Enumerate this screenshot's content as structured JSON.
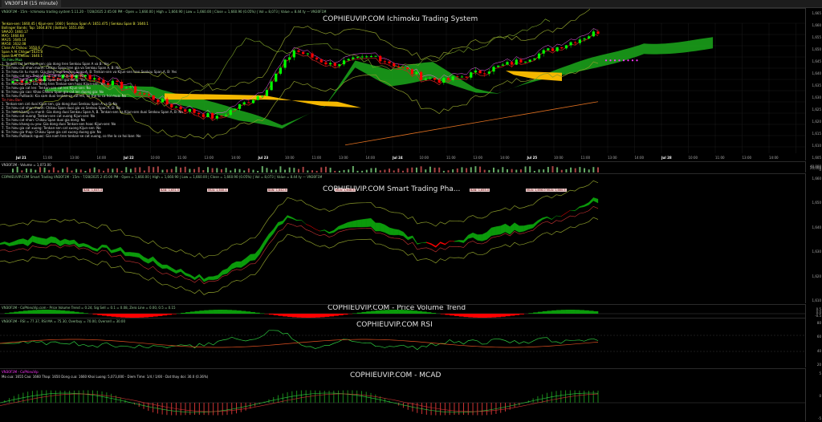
{
  "window": {
    "tab_title": "VN30F1M (15 minute)"
  },
  "panes": {
    "ichimoku": {
      "title": "COPHIEUVIP.COM Ichimoku Trading System",
      "header": "VN30F1M - 15m - Ichimoku trading system 5.11.20 - 7/28/2025 2:45:00 PM - Open = 1,660.00 | High = 1,660.90 | Low = 1,660.00 | Close = 1,660.90 (0.05%) | Vol = 8,073 | Value = 8.44 ty — VN30F1M",
      "info_lines": [
        "Tenkan-sen: 1660.45 | Kijun-sen: 1660 | Senkou Span A: 1651.475 | Senkou Span B: 1640.1",
        "Bollinger Bands: Top: 1664.874 | Bottom: 1651.466",
        "SMA20: 1660.17",
        "MA5: 1660.68",
        "MA25: 1646.14",
        "MA50: 1632.08",
        "Close At Chikou: 1650.6",
        "Span A At Chikou: 1631.8",
        "Span B At Chikou: 1640.1",
        "Tin hieu Mua",
        "1. Tenkan cat len Kijun-sen: gia dong tren Senkou Span A va B: Yes",
        "2. Tin hieu cat nhan manh: Chikou Span tren gia va Senkou Span A, B: No",
        "3. Tin hieu tin tu manh: Gia dong tren Senkou Span A, B. Tenkan-sen va Kijun-sen tren Senkou Span A, B: Yes",
        "4. Tin hieu cat len: Tenkan-sen cat len Kijun-sen: No",
        "5. Tin hieu cat nhan: Chikou Span tren gia dong: Yes",
        "6. Tin hieu tin yeu: Gia dong tren Tenkan-sen hoac Kijun-sen: Yes",
        "7. Tin hieu gia cat len: Tenkan-sen cat len Kijun-sen: No",
        "8. Tin hieu gia cao: Khao Chikou Span gia cat len duong gia: No",
        "9. Tin hieu Pullback: Kia sam duoi tenkan-se cat len, co the tu ca hoi mua: No",
        "Tin hieu Ban",
        "1. Tenkan-sen cat duoi Kijun-sen, gia dong duoi Senkou Span A va B: No",
        "2. Tin hieu cat nhan manh: Chikou Span duoi gia va Senkou Span A, B: No",
        "3. Tin hieu khang cu manh: Gia dong duoi Senkou Span A, B. Tenkan-sen va Kijun-sen duoi Senkou Span A, B: No",
        "4. Tin hieu cat xuong: Tenkan-sen cat xuong Kijun-sen: No",
        "5. Tin hieu cat nhan: Chikou Span duoi gia dong: No",
        "6. Tin hieu khang cu yeu: Gia dong duoi Tenkan-sen hoac Kijun-sen: No",
        "7. Tin hieu gia cat xuong: Tenkan-sen cat xuong Kijun-sen: No",
        "8. Tin hieu gia thap: Chikou Span gia cat xuong duong gia: No",
        "9. Tin hieu Pullback nguoc: Gia nam tren tenkan-se cat xuong, co the la co hoi ban: No"
      ],
      "x_labels": [
        "Jul 21",
        "11:00",
        "13:00",
        "14:00",
        "Jul 22",
        "10:00",
        "11:00",
        "13:00",
        "14:00",
        "Jul 23",
        "10:00",
        "11:00",
        "13:00",
        "14:00",
        "Jul 24",
        "10:00",
        "11:00",
        "13:00",
        "14:00",
        "Jul 25",
        "10:00",
        "11:00",
        "13:00",
        "14:00",
        "Jul 28",
        "10:00",
        "11:00",
        "13:00",
        "14:00"
      ],
      "y_labels": [
        "1,665",
        "1,660",
        "1,655",
        "1,650",
        "1,645",
        "1,640",
        "1,635",
        "1,630",
        "1,625",
        "1,620",
        "1,615",
        "1,610",
        "1,605"
      ]
    },
    "volume": {
      "header": "VN30F1M - Volume = 1,073.00",
      "y_labels": [
        "40,000",
        "20,000",
        "0"
      ]
    },
    "smart": {
      "title": "COPHIEUVIP.COM Smart Trading Pha...",
      "header": "COPHIEUVIP.COM Smart Trading VN30F1M - 15m - 7/28/2025 2:45:00 PM - Open = 1,660.00 | High = 1,660.90 | Low = 1,660.00 | Close = 1,660.90 (0.05%) | Vol = 8,073 | Value = 8.44 ty — VN30F1M",
      "tags": [
        "BAN: 1,645.4",
        "BAN: 1,631.5",
        "MUA: 1,640.1",
        "BAN: 1,642.9",
        "MUA: 1,648.8",
        "BAN: 1,655.0",
        "MUA: 1,656.0",
        "MUA: 1,660.5"
      ],
      "y_labels": [
        "1,660",
        "1,650",
        "1,640",
        "1,630",
        "1,620",
        "1,610"
      ]
    },
    "pvt": {
      "title": "COPHIEUVIP.COM - Price Volume Trend",
      "header": "VN30F1M - CoPhieuVip.com - Price Volume Trend = 0.24, Sig Sell = 0.1 = 0.08, Zero Line = 0.00, 0.5 = 0.15",
      "y_labels": [
        "0.5",
        "0.0",
        "-0.5"
      ]
    },
    "rsi": {
      "title": "COPHIEUVIP.COM RSI",
      "header": "VN30F1M - RSI = 77.37, RSI MA = 75.30, Overbuy = 70.00, Oversell = 30.00",
      "y_labels": [
        "80",
        "60",
        "40",
        "20"
      ]
    },
    "macd": {
      "title": "COPHIEUVIP.COM - MCAD",
      "header": "Mo cua: 1655 Cao: 1660 Thap: 1650 Dong cua: 1660 Khoi Luong: 5,073,000 - Diem Time: 1/4 / 1/00 - Dat thay doi: 30.0 (0.36%)",
      "header_tag": "VN30F1M - CoPhieuVip",
      "y_labels": [
        "5",
        "0",
        "-5"
      ]
    }
  },
  "colors": {
    "bull": "#00ff00",
    "bear": "#ff0000",
    "cloud": "#1a9e1a",
    "kumo_gold": "#f5b800",
    "grid": "#222"
  }
}
